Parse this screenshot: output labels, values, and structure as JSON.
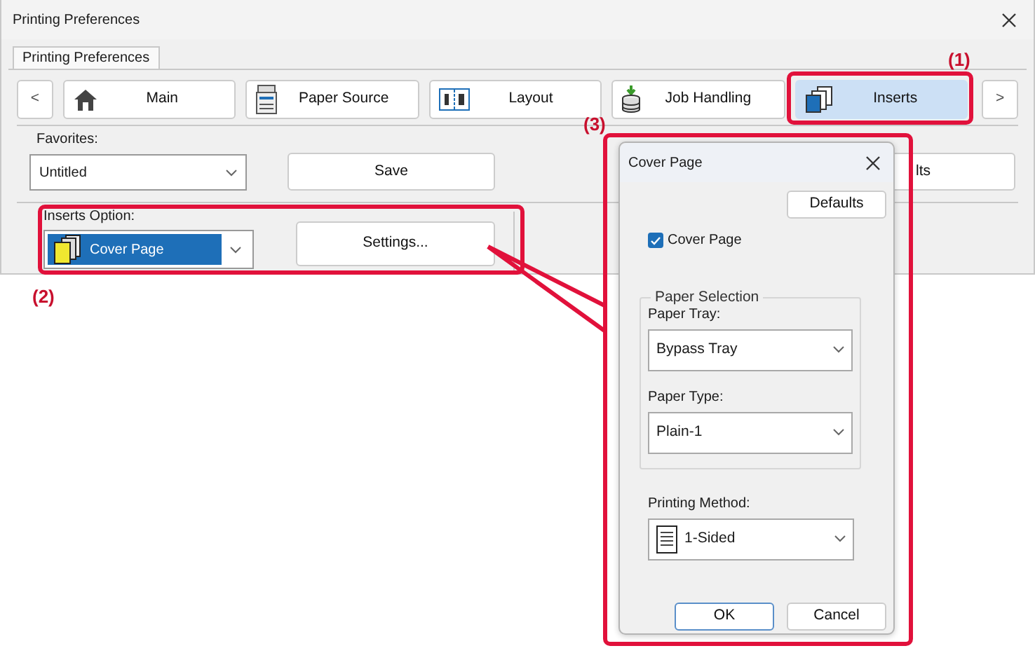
{
  "window": {
    "title": "Printing Preferences"
  },
  "page_tab": {
    "label": "Printing Preferences"
  },
  "nav": {
    "prev": "<",
    "next": ">",
    "tabs": [
      {
        "label": "Main",
        "selected": false
      },
      {
        "label": "Paper Source",
        "selected": false
      },
      {
        "label": "Layout",
        "selected": false
      },
      {
        "label": "Job Handling",
        "selected": false
      },
      {
        "label": "Inserts",
        "selected": true
      }
    ]
  },
  "favorites": {
    "label": "Favorites:",
    "value": "Untitled"
  },
  "save_button": "Save",
  "covered_button": "lts",
  "inserts_option": {
    "label": "Inserts Option:",
    "value": "Cover Page",
    "selected": true
  },
  "settings_button": "Settings...",
  "dialog": {
    "title": "Cover Page",
    "defaults_button": "Defaults",
    "cover_page": {
      "label": "Cover Page",
      "checked": true
    },
    "paper_selection": {
      "legend": "Paper Selection",
      "paper_tray": {
        "label": "Paper Tray:",
        "value": "Bypass Tray"
      },
      "paper_type": {
        "label": "Paper Type:",
        "value": "Plain-1"
      }
    },
    "printing_method": {
      "label": "Printing Method:",
      "value": "1-Sided"
    },
    "buttons": [
      {
        "label": "OK",
        "default": true
      },
      {
        "label": "Cancel",
        "default": false
      }
    ]
  },
  "callouts": [
    "(1)",
    "(2)",
    "(3)"
  ]
}
